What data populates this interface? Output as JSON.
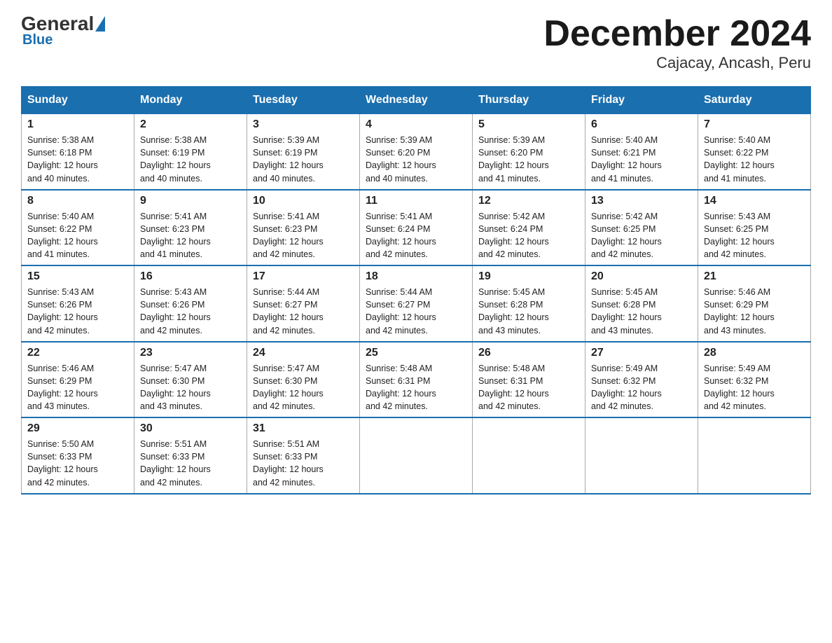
{
  "logo": {
    "general": "General",
    "blue": "Blue"
  },
  "title": "December 2024",
  "subtitle": "Cajacay, Ancash, Peru",
  "days_of_week": [
    "Sunday",
    "Monday",
    "Tuesday",
    "Wednesday",
    "Thursday",
    "Friday",
    "Saturday"
  ],
  "weeks": [
    [
      {
        "day": "1",
        "sunrise": "5:38 AM",
        "sunset": "6:18 PM",
        "daylight": "12 hours and 40 minutes."
      },
      {
        "day": "2",
        "sunrise": "5:38 AM",
        "sunset": "6:19 PM",
        "daylight": "12 hours and 40 minutes."
      },
      {
        "day": "3",
        "sunrise": "5:39 AM",
        "sunset": "6:19 PM",
        "daylight": "12 hours and 40 minutes."
      },
      {
        "day": "4",
        "sunrise": "5:39 AM",
        "sunset": "6:20 PM",
        "daylight": "12 hours and 40 minutes."
      },
      {
        "day": "5",
        "sunrise": "5:39 AM",
        "sunset": "6:20 PM",
        "daylight": "12 hours and 41 minutes."
      },
      {
        "day": "6",
        "sunrise": "5:40 AM",
        "sunset": "6:21 PM",
        "daylight": "12 hours and 41 minutes."
      },
      {
        "day": "7",
        "sunrise": "5:40 AM",
        "sunset": "6:22 PM",
        "daylight": "12 hours and 41 minutes."
      }
    ],
    [
      {
        "day": "8",
        "sunrise": "5:40 AM",
        "sunset": "6:22 PM",
        "daylight": "12 hours and 41 minutes."
      },
      {
        "day": "9",
        "sunrise": "5:41 AM",
        "sunset": "6:23 PM",
        "daylight": "12 hours and 41 minutes."
      },
      {
        "day": "10",
        "sunrise": "5:41 AM",
        "sunset": "6:23 PM",
        "daylight": "12 hours and 42 minutes."
      },
      {
        "day": "11",
        "sunrise": "5:41 AM",
        "sunset": "6:24 PM",
        "daylight": "12 hours and 42 minutes."
      },
      {
        "day": "12",
        "sunrise": "5:42 AM",
        "sunset": "6:24 PM",
        "daylight": "12 hours and 42 minutes."
      },
      {
        "day": "13",
        "sunrise": "5:42 AM",
        "sunset": "6:25 PM",
        "daylight": "12 hours and 42 minutes."
      },
      {
        "day": "14",
        "sunrise": "5:43 AM",
        "sunset": "6:25 PM",
        "daylight": "12 hours and 42 minutes."
      }
    ],
    [
      {
        "day": "15",
        "sunrise": "5:43 AM",
        "sunset": "6:26 PM",
        "daylight": "12 hours and 42 minutes."
      },
      {
        "day": "16",
        "sunrise": "5:43 AM",
        "sunset": "6:26 PM",
        "daylight": "12 hours and 42 minutes."
      },
      {
        "day": "17",
        "sunrise": "5:44 AM",
        "sunset": "6:27 PM",
        "daylight": "12 hours and 42 minutes."
      },
      {
        "day": "18",
        "sunrise": "5:44 AM",
        "sunset": "6:27 PM",
        "daylight": "12 hours and 42 minutes."
      },
      {
        "day": "19",
        "sunrise": "5:45 AM",
        "sunset": "6:28 PM",
        "daylight": "12 hours and 43 minutes."
      },
      {
        "day": "20",
        "sunrise": "5:45 AM",
        "sunset": "6:28 PM",
        "daylight": "12 hours and 43 minutes."
      },
      {
        "day": "21",
        "sunrise": "5:46 AM",
        "sunset": "6:29 PM",
        "daylight": "12 hours and 43 minutes."
      }
    ],
    [
      {
        "day": "22",
        "sunrise": "5:46 AM",
        "sunset": "6:29 PM",
        "daylight": "12 hours and 43 minutes."
      },
      {
        "day": "23",
        "sunrise": "5:47 AM",
        "sunset": "6:30 PM",
        "daylight": "12 hours and 43 minutes."
      },
      {
        "day": "24",
        "sunrise": "5:47 AM",
        "sunset": "6:30 PM",
        "daylight": "12 hours and 42 minutes."
      },
      {
        "day": "25",
        "sunrise": "5:48 AM",
        "sunset": "6:31 PM",
        "daylight": "12 hours and 42 minutes."
      },
      {
        "day": "26",
        "sunrise": "5:48 AM",
        "sunset": "6:31 PM",
        "daylight": "12 hours and 42 minutes."
      },
      {
        "day": "27",
        "sunrise": "5:49 AM",
        "sunset": "6:32 PM",
        "daylight": "12 hours and 42 minutes."
      },
      {
        "day": "28",
        "sunrise": "5:49 AM",
        "sunset": "6:32 PM",
        "daylight": "12 hours and 42 minutes."
      }
    ],
    [
      {
        "day": "29",
        "sunrise": "5:50 AM",
        "sunset": "6:33 PM",
        "daylight": "12 hours and 42 minutes."
      },
      {
        "day": "30",
        "sunrise": "5:51 AM",
        "sunset": "6:33 PM",
        "daylight": "12 hours and 42 minutes."
      },
      {
        "day": "31",
        "sunrise": "5:51 AM",
        "sunset": "6:33 PM",
        "daylight": "12 hours and 42 minutes."
      },
      null,
      null,
      null,
      null
    ]
  ],
  "labels": {
    "sunrise": "Sunrise:",
    "sunset": "Sunset:",
    "daylight": "Daylight:"
  }
}
